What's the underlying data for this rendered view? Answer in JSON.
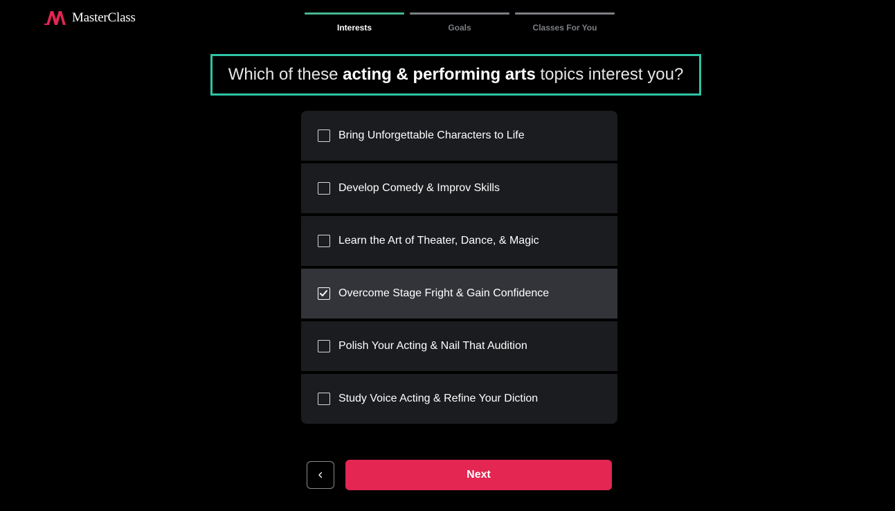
{
  "brand": {
    "name": "MasterClass",
    "accent_color": "#e32652"
  },
  "steps": [
    {
      "label": "Interests",
      "active": true
    },
    {
      "label": "Goals",
      "active": false
    },
    {
      "label": "Classes For You",
      "active": false
    }
  ],
  "question": {
    "prefix": "Which of these ",
    "highlight": "acting & performing arts",
    "suffix": " topics interest you?"
  },
  "options": [
    {
      "label": "Bring Unforgettable Characters to Life",
      "checked": false
    },
    {
      "label": "Develop Comedy & Improv Skills",
      "checked": false
    },
    {
      "label": "Learn the Art of Theater, Dance, & Magic",
      "checked": false
    },
    {
      "label": "Overcome Stage Fright & Gain Confidence",
      "checked": true
    },
    {
      "label": "Polish Your Acting & Nail That Audition",
      "checked": false
    },
    {
      "label": "Study Voice Acting & Refine Your Diction",
      "checked": false
    }
  ],
  "buttons": {
    "back_icon": "chevron-left-icon",
    "next_label": "Next"
  }
}
